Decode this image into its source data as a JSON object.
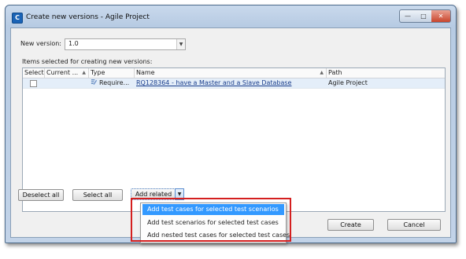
{
  "window": {
    "title": "Create new versions - Agile Project"
  },
  "version": {
    "label": "New version:",
    "value": "1.0"
  },
  "items_label": "Items selected for creating new versions:",
  "table": {
    "columns": [
      "Select",
      "Current ...",
      "Type",
      "Name",
      "Path"
    ],
    "rows": [
      {
        "selected": false,
        "current": "",
        "type": "Require...",
        "name": "RQ128364 - have a Master and a Slave Database",
        "path": "Agile Project"
      }
    ]
  },
  "buttons": {
    "deselect_all": "Deselect all",
    "select_all": "Select all",
    "add_related": "Add related",
    "create": "Create",
    "cancel": "Cancel"
  },
  "menu": {
    "items": [
      "Add test cases for selected test scenarios",
      "Add test scenarios for selected test cases",
      "Add nested test cases for selected test cases"
    ],
    "highlighted_index": 0
  },
  "colors": {
    "highlight": "#3399ff",
    "annotation": "#d41f1f",
    "link": "#1a3e8c"
  }
}
